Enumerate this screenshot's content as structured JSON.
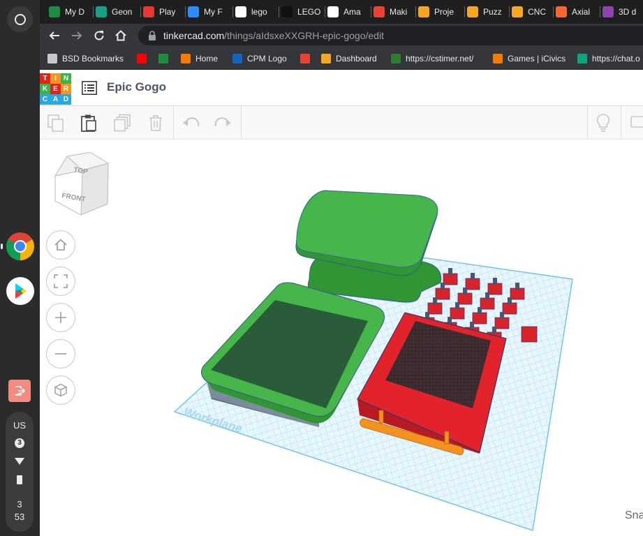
{
  "shelf": {
    "locale": "US",
    "notification_count": "3",
    "clock_hour": "3",
    "clock_minute": "53"
  },
  "tabs": [
    {
      "label": "My D",
      "icon": "google-drive-icon",
      "color": "#1e8e3e"
    },
    {
      "label": "Geon",
      "icon": "geogebra-icon",
      "color": "#16a085"
    },
    {
      "label": "Play",
      "icon": "blooket-icon",
      "color": "#e53935"
    },
    {
      "label": "My F",
      "icon": "zoom-icon",
      "color": "#2d8cff"
    },
    {
      "label": "lego",
      "icon": "google-icon",
      "color": "#ffffff"
    },
    {
      "label": "LEGO",
      "icon": "lego-icon",
      "color": "#111111"
    },
    {
      "label": "Ama",
      "icon": "amazon-icon",
      "color": "#ffffff"
    },
    {
      "label": "Maki",
      "icon": "gmail-icon",
      "color": "#ea4335"
    },
    {
      "label": "Proje",
      "icon": "tinkercad-icon",
      "color": "#f5a623"
    },
    {
      "label": "Puzz",
      "icon": "tinkercad-icon",
      "color": "#f5a623"
    },
    {
      "label": "CNC",
      "icon": "tinkercad-icon",
      "color": "#f5a623"
    },
    {
      "label": "Axial",
      "icon": "printables-icon",
      "color": "#fa6831"
    },
    {
      "label": "3D d",
      "icon": "site-icon",
      "color": "#8e44ad"
    }
  ],
  "address": {
    "domain": "tinkercad.com",
    "path": "/things/aIdsxeXXGRH-epic-gogo/edit"
  },
  "bookmarks": [
    {
      "label": "BSD Bookmarks",
      "icon": "folder-icon",
      "color": "#c8c8c8"
    },
    {
      "label": "",
      "icon": "youtube-icon",
      "color": "#ff0000"
    },
    {
      "label": "",
      "icon": "google-drive-icon",
      "color": "#1e8e3e"
    },
    {
      "label": "Home",
      "icon": "home-shield-icon",
      "color": "#f57c00"
    },
    {
      "label": "CPM Logo",
      "icon": "cpm-icon",
      "color": "#1565c0"
    },
    {
      "label": "",
      "icon": "gmail-icon",
      "color": "#ea4335"
    },
    {
      "label": "Dashboard",
      "icon": "dashboard-icon",
      "color": "#f5a623"
    },
    {
      "label": "https://cstimer.net/",
      "icon": "cstimer-icon",
      "color": "#2e7d32"
    },
    {
      "label": "Games | iCivics",
      "icon": "icivics-icon",
      "color": "#f57c00"
    },
    {
      "label": "https://chat.o",
      "icon": "openai-icon",
      "color": "#10a37f"
    }
  ],
  "app": {
    "logo_letters": [
      "T",
      "I",
      "N",
      "K",
      "E",
      "R",
      "C",
      "A",
      "D"
    ],
    "logo_colors": [
      "#e2231a",
      "#f7941d",
      "#39b54a",
      "#39b54a",
      "#e2231a",
      "#f7941d",
      "#27aae1",
      "#27aae1",
      "#27aae1"
    ],
    "title": "Epic Gogo"
  },
  "viewcube": {
    "top_label": "TOP",
    "front_label": "FRONT"
  },
  "workplane_label": "Workplane",
  "snap_label": "Sna"
}
